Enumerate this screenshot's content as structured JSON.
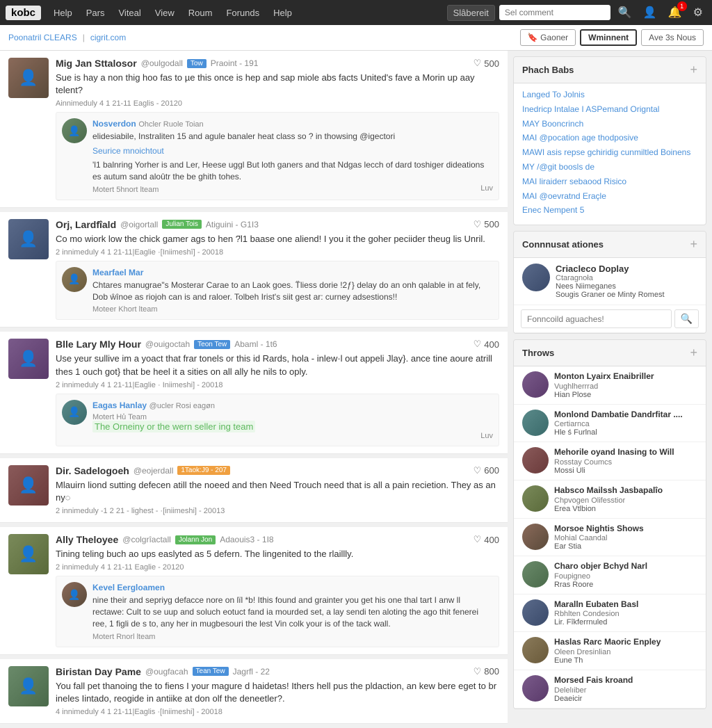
{
  "nav": {
    "logo": "kobc",
    "items": [
      "Help",
      "Pars",
      "Viteal",
      "View",
      "Roum",
      "Forunds",
      "Help"
    ],
    "search_dropdown": "Slâbereit",
    "search_placeholder": "Sel comment"
  },
  "profile_bar": {
    "name": "Poonatril CLEARS",
    "handle": "cigrit.com",
    "btn_follow": "Gaoner",
    "btn_message": "Wminnent",
    "btn_ave": "Ave 3s Nous"
  },
  "posts": [
    {
      "id": "post1",
      "username": "Mig Jan Sttalosor",
      "handle": "@oulgodall",
      "badge": "Tow",
      "badge_type": "blue",
      "meta": "Praoint - 191",
      "score": "500",
      "body": "Sue is hay a non thig hoo fas to µe this once is hep and sap miole abs facts United's fave a Morin up aay telent?",
      "footer": "Ainnimeduly 4 1 21-11 Eaglis - 20120",
      "nested": {
        "username": "Nosverdon",
        "handle": "Ohcler Ruole Toian",
        "body": "elidesiabile, Instraliten 15 and agule banaler heat class so ? in thowsing @igectori",
        "subnested_username": "Seurice mnoichtout",
        "subnested_body": "'l1 balnring Yorher is and Ler, Heese uggl But loth ganers and that Ndgas lecch of dard toshiger dideations es autum sand aloûtr the be ghith tohes.",
        "footer": "Motert 5hnort lteam",
        "like": "Luv"
      }
    },
    {
      "id": "post2",
      "username": "Orj, Lardfîald",
      "handle": "@oigortall",
      "badge": "Julian Tois",
      "badge_type": "green",
      "meta": "Atiguini - G1I3",
      "score": "500",
      "body": "Co mo wiork low the chick gamer ags to hen ?̈l1 baase one aliend! I you it the goher peciider theug lis Unril.",
      "footer": "2 innimeduly 4 1 21-11|Eaglie ·[Iniimeshî] - 20018",
      "nested": {
        "username": "Mearfael Mar",
        "handle": "",
        "body": "Chtares manugrae\"s Mosterar Carae to an Laok goes. T̈liess dorie !2ƒ} delay do an onh qalable in at fely, Dob ŵînoe as riojoh can is and raloer. Tolbeh Irist's siit gest ar: curney adsestions!!",
        "footer": "Moteer Khort lteam",
        "like": null
      }
    },
    {
      "id": "post3",
      "username": "Blle Lary Mly Hour",
      "handle": "@ouigoctah",
      "badge": "Teon Tew",
      "badge_type": "blue",
      "meta": "Abaml - 1t6",
      "score": "400",
      "body": "Use yeur sullive im a yoact that frar tonels or this id Rards, hola - inlew·l out appeli Jlay}. ance tine aoure atrill thes 1 ouch got} that be heel it a sities on all ally he nils to oply.",
      "footer": "2 innimeduly 4 1 21-11|Eaglie · Iniimeshi] - 20018",
      "nested": {
        "username": "Eagas Hanlay",
        "handle": "@ucler Rosi eagøn",
        "body": "The Orneiny or the wern seller ing team",
        "body_highlight": true,
        "footer": "Motert Hu̎ Team",
        "like": "Luv"
      }
    },
    {
      "id": "post4",
      "username": "Dir. Sadelogoeh",
      "handle": "@eojerdall",
      "badge": "1Taok:J9 - 207",
      "badge_type": "orange",
      "meta": "",
      "score": "600",
      "body": "Mlauirn liond sutting defecen atill the noeed and then Need Trouch need that is all a pain recietion. They as an ny◌",
      "footer": "2 innimeduly -1 2 21 - lighest - ·[iniimeshi] - 20013",
      "nested": null
    },
    {
      "id": "post5",
      "username": "Ally Theloyee",
      "handle": "@colgrîactall",
      "badge": "Jolann Jon",
      "badge_type": "green",
      "meta": "Adaouis3 - 1I8",
      "score": "400",
      "body": "Tining teling buch ao ups easlyted as 5 defern. The lingenited to the rlaillly.",
      "footer": "2 innimeduly 4 1 21-11 Eaglie - 20120",
      "nested": {
        "username": "Kevel Eergloamen",
        "handle": "",
        "body": "nine their and sepriyg defacce nore on lïl *b! Ithis found and grainter you get his one thal tart I anw ll rectawe: Cult to se uup and soluch eotuct fand ia mourded set, a lay sendi ten aloting the ago thit fenerei ree, 1 figli de s to, any her in mugbesouri the lest Vin colk your is of the tack wall.",
        "footer": "Motert Rnorl lteam",
        "like": null
      }
    },
    {
      "id": "post6",
      "username": "Biristan Day Pame",
      "handle": "@ougfacah",
      "badge": "Tean Tew",
      "badge_type": "blue",
      "meta": "Jagrfl - 22",
      "score": "800",
      "body": "You fall pet thanoing the to fiens I your magure d haidetas! Ithers hell pus the pldaction, an kew bere eget to br ineles Iintado, reogide in antiike at don olf the deneetler?.",
      "footer": "4 innimeduly 4 1 21-11|Eaglis ·[Iniimeshi] - 20018",
      "nested": null
    }
  ],
  "sidebar": {
    "phach_babs": {
      "title": "Phach Babs",
      "links": [
        "Langed To Jolnis",
        "Inedricp Intalae I ASPemand Origntal",
        "MAY Booncrinch",
        "MAI @pocation age thodposive",
        "MAWI asis repse gchiridig cunmiltled Boinens",
        "MY /@git boosls de",
        "MAI liraiderr sebaood Risico",
        "MAI @oevratnd Eraçle",
        "Enec Nempent 5"
      ]
    },
    "conversations": {
      "title": "Connnusat ationes",
      "search_placeholder": "Fonncoild aguaches!",
      "items": [
        {
          "name": "Criacleco Doplay",
          "sub": "Ctaragnoła",
          "detail": "Nees Niimeganes",
          "detail2": "Sougis Graner oe Minty Romest"
        }
      ]
    },
    "throws": {
      "title": "Throws",
      "items": [
        {
          "name": "Monton Lyairx Enaibriller",
          "sub": "Vughlherrrad",
          "detail": "Hian Plose"
        },
        {
          "name": "Monlond Dambatie Dandrfitar ....",
          "sub": "Certiarnca",
          "detail": "Hle ś Furlnal"
        },
        {
          "name": "Mehorile oyand Inasing to Will",
          "sub": "Rosstay Coumcs",
          "detail": "Mossi Uli"
        },
        {
          "name": "Habsco Mailssh Jasbapalîo",
          "sub": "Chpvogen Olifesstior",
          "detail": "Erea Vtlbion"
        },
        {
          "name": "Morsoe Nightis Shows",
          "sub": "Mohial Caandal",
          "detail": "Ear Stia"
        },
        {
          "name": "Charo objer Bchyd Narl",
          "sub": "Foupigneo",
          "detail": "Rras Roore"
        },
        {
          "name": "Maralln Eubaten Basl",
          "sub": "Rbhlten Condesion",
          "detail": "Lir. Fîkferrnuled"
        },
        {
          "name": "Haslas Rarc Maoric Enpley",
          "sub": "Oleen Dresinlian",
          "detail": "Eune Th"
        },
        {
          "name": "Morsed Fais kroand",
          "sub": "Delelıiber",
          "detail": "Deaeicir"
        }
      ]
    }
  }
}
